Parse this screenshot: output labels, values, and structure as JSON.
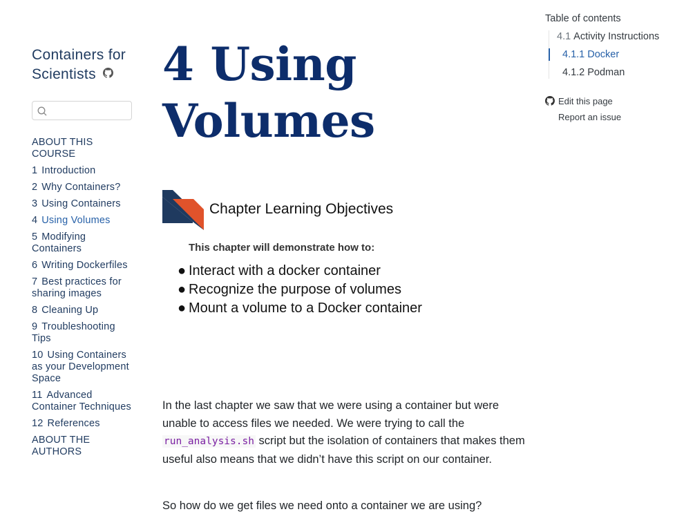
{
  "sidebar": {
    "title": "Containers for Scientists",
    "title_line1": "Containers for",
    "title_line2": "Scientists",
    "search_placeholder": "",
    "section_top": "ABOUT THIS COURSE",
    "items": [
      {
        "num": "1",
        "label": "Introduction"
      },
      {
        "num": "2",
        "label": "Why Containers?"
      },
      {
        "num": "3",
        "label": "Using Containers"
      },
      {
        "num": "4",
        "label": "Using Volumes"
      },
      {
        "num": "5",
        "label": "Modifying Containers"
      },
      {
        "num": "6",
        "label": "Writing Dockerfiles"
      },
      {
        "num": "7",
        "label": "Best practices for sharing images"
      },
      {
        "num": "8",
        "label": "Cleaning Up"
      },
      {
        "num": "9",
        "label": "Troubleshooting Tips"
      },
      {
        "num": "10",
        "label": "Using Containers as your Development Space"
      },
      {
        "num": "11",
        "label": "Advanced Container Techniques"
      },
      {
        "num": "12",
        "label": "References"
      }
    ],
    "section_bottom": "ABOUT THE AUTHORS"
  },
  "main": {
    "chapter_num": "4",
    "chapter_title_line1": "Using",
    "chapter_title_line2": "Volumes",
    "objectives": {
      "heading": "Chapter Learning Objectives",
      "subheading": "This chapter will demonstrate how to:",
      "items": [
        "Interact with a docker container",
        "Recognize the purpose of volumes",
        "Mount a volume to a Docker container"
      ]
    },
    "p1_before": "In the last chapter we saw that we were using a container but were unable to access files we needed. We were trying to call the ",
    "p1_code": "run_analysis.sh",
    "p1_after": " script but the isolation of containers that makes them useful also means that we didn’t have this script on our container.",
    "p2": "So how do we get files we need onto a container we are using?"
  },
  "toc": {
    "title": "Table of contents",
    "entries": [
      {
        "num": "4.1",
        "label": "Activity Instructions"
      },
      {
        "num": "4.1.1",
        "label": "Docker"
      },
      {
        "num": "4.1.2",
        "label": "Podman"
      }
    ],
    "edit_label": "Edit this page",
    "issue_label": "Report an issue"
  },
  "colors": {
    "nav_text": "#213c61",
    "active_link": "#2761a8",
    "title_blue": "#0d2d6b",
    "logo_navy": "#1f3a5f",
    "logo_orange": "#e0532b",
    "code_purple": "#7a1fa2"
  },
  "icons": {
    "github": "github-icon",
    "search": "search-icon"
  }
}
